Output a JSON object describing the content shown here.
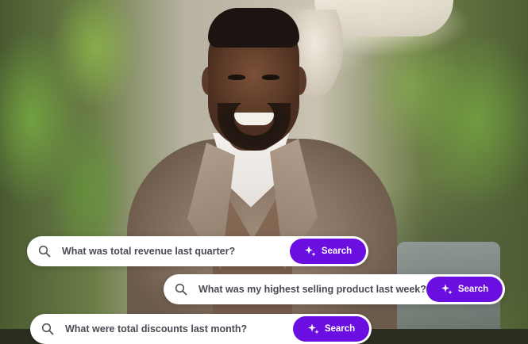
{
  "searches": [
    {
      "query": "What was total revenue last quarter?",
      "button_label": "Search"
    },
    {
      "query": "What was my highest selling product last week?",
      "button_label": "Search"
    },
    {
      "query": "What were total discounts last month?",
      "button_label": "Search"
    }
  ],
  "icons": {
    "search": "search-icon",
    "sparkle": "sparkle-icon"
  },
  "colors": {
    "accent": "#6b0fe0",
    "bar_background": "#ffffff",
    "query_text": "#4a4a55"
  }
}
